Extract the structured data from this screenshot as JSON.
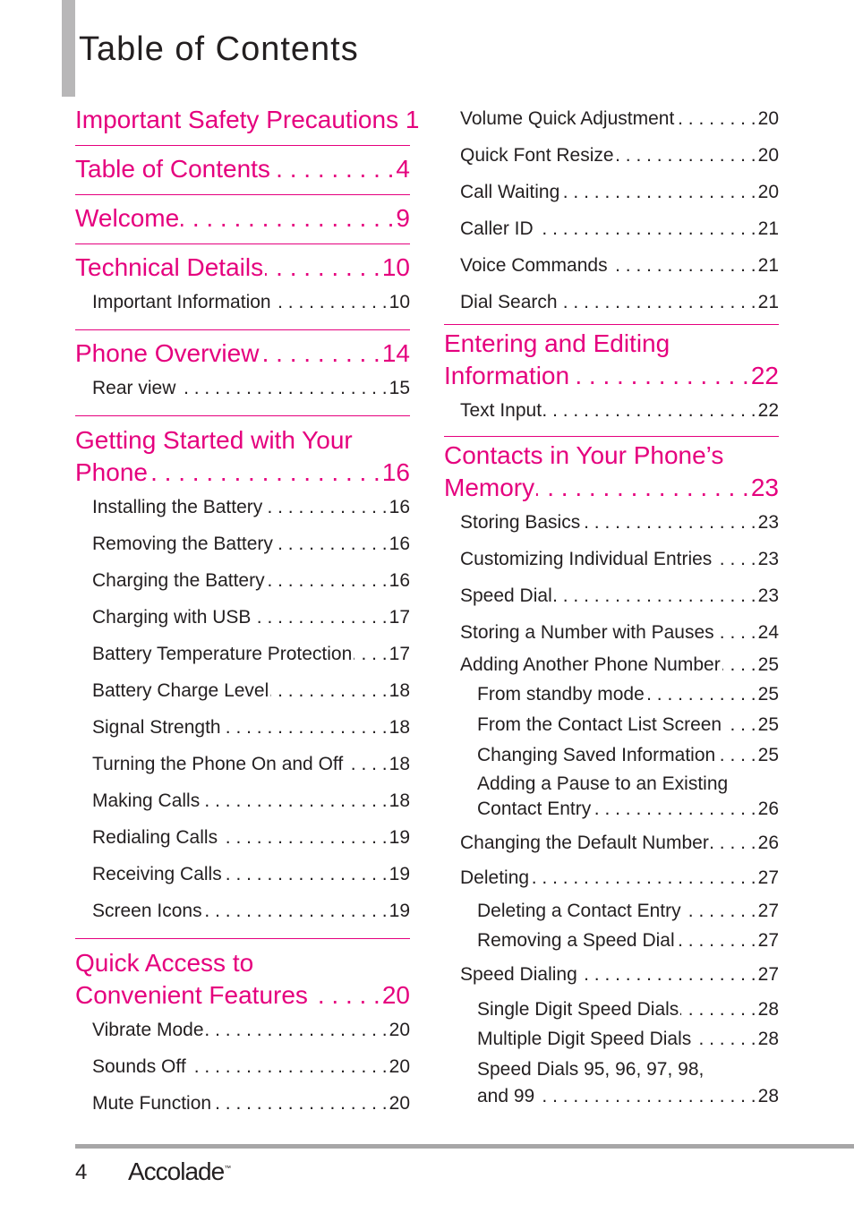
{
  "page": {
    "title": "Table of Contents",
    "page_number": "4",
    "brand": "Accolade",
    "brand_mark": "™",
    "accent_color": "#e5007e"
  },
  "left": [
    {
      "title": "Important Safety Precautions 1",
      "page": "",
      "items": []
    },
    {
      "title": "Table of Contents",
      "page": "4",
      "items": []
    },
    {
      "title": "Welcome",
      "page": "9",
      "items": []
    },
    {
      "title": "Technical Details",
      "page": "10",
      "items": [
        {
          "label": "Important Information",
          "page": "10"
        }
      ]
    },
    {
      "title": "Phone Overview",
      "page": "14",
      "items": [
        {
          "label": "Rear view",
          "page": "15"
        }
      ]
    },
    {
      "title_line1": "Getting Started with Your",
      "title": "Phone",
      "page": "16",
      "items": [
        {
          "label": "Installing the Battery",
          "page": "16"
        },
        {
          "label": "Removing the Battery",
          "page": "16"
        },
        {
          "label": "Charging the Battery",
          "page": "16"
        },
        {
          "label": "Charging with USB",
          "page": "17"
        },
        {
          "label": "Battery Temperature Protection",
          "page": "17"
        },
        {
          "label": "Battery Charge Level",
          "page": "18"
        },
        {
          "label": "Signal Strength",
          "page": "18"
        },
        {
          "label": "Turning the Phone On and Off",
          "page": "18"
        },
        {
          "label": "Making Calls",
          "page": "18"
        },
        {
          "label": "Redialing Calls",
          "page": "19"
        },
        {
          "label": "Receiving Calls",
          "page": "19"
        },
        {
          "label": "Screen Icons",
          "page": "19"
        }
      ]
    },
    {
      "title_line1": "Quick Access to",
      "title": "Convenient Features",
      "page": "20",
      "items": [
        {
          "label": "Vibrate Mode",
          "page": "20"
        },
        {
          "label": "Sounds Off",
          "page": "20"
        },
        {
          "label": "Mute Function",
          "page": "20"
        }
      ]
    }
  ],
  "right": {
    "continued_items": [
      {
        "label": "Volume Quick Adjustment",
        "page": "20"
      },
      {
        "label": "Quick Font Resize",
        "page": "20"
      },
      {
        "label": "Call Waiting",
        "page": "20"
      },
      {
        "label": "Caller ID",
        "page": "21"
      },
      {
        "label": "Voice Commands",
        "page": "21"
      },
      {
        "label": "Dial Search",
        "page": "21"
      }
    ],
    "entering": {
      "title_line1": "Entering and Editing",
      "title": "Information",
      "page": "22",
      "items": [
        {
          "label": "Text Input",
          "page": "22"
        }
      ]
    },
    "contacts": {
      "title_line1": "Contacts in Your Phone’s",
      "title": "Memory",
      "page": "23",
      "items": [
        {
          "label": "Storing Basics",
          "page": "23"
        },
        {
          "label": "Customizing Individual Entries",
          "page": "23"
        },
        {
          "label": "Speed Dial",
          "page": "23"
        },
        {
          "label": "Storing a Number with Pauses",
          "page": "24"
        }
      ],
      "adding_another": {
        "label": "Adding Another Phone Number",
        "page": "25",
        "subs": [
          {
            "label": "From standby mode",
            "page": "25"
          },
          {
            "label": "From the Contact List Screen",
            "page": "25"
          },
          {
            "label": "Changing Saved Information",
            "page": "25"
          }
        ],
        "pause_line1": "Adding a Pause to an Existing",
        "pause_label": "Contact Entry",
        "pause_page": "26"
      },
      "changing_default": {
        "label": "Changing the Default Number",
        "page": "26"
      },
      "deleting": {
        "label": "Deleting",
        "page": "27",
        "subs": [
          {
            "label": "Deleting a Contact Entry",
            "page": "27"
          },
          {
            "label": "Removing a Speed Dial",
            "page": "27"
          }
        ]
      },
      "speed_dialing": {
        "label": "Speed Dialing",
        "page": "27",
        "subs": [
          {
            "label": "Single Digit Speed Dials",
            "page": "28"
          },
          {
            "label": "Multiple Digit Speed Dials",
            "page": "28"
          }
        ],
        "last_line1": "Speed Dials 95, 96, 97, 98,",
        "last_label": "and 99",
        "last_page": "28"
      }
    }
  }
}
